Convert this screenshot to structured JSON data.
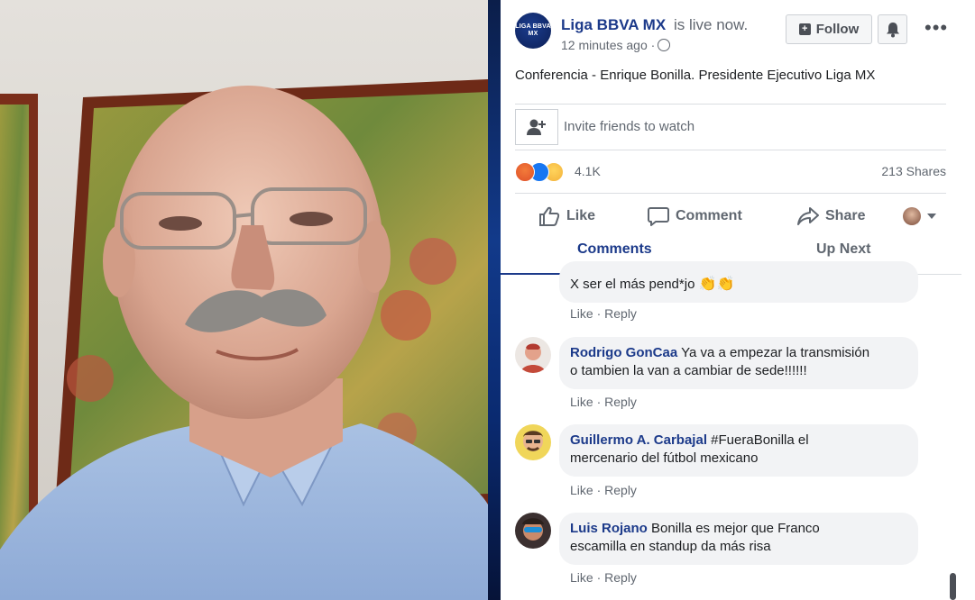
{
  "header": {
    "logo_text": "LIGA BBVA MX",
    "page_name": "Liga BBVA MX",
    "live_text": "is live now.",
    "time": "12 minutes ago ·",
    "follow_label": "Follow"
  },
  "post": {
    "description": "Conferencia - Enrique Bonilla. Presidente Ejecutivo Liga MX",
    "invite_placeholder": "Invite friends to watch",
    "reaction_count": "4.1K",
    "shares": "213 Shares"
  },
  "actions": {
    "like": "Like",
    "comment": "Comment",
    "share": "Share"
  },
  "tabs": {
    "comments": "Comments",
    "up_next": "Up Next"
  },
  "comments": [
    {
      "name": "",
      "text": "X ser el más pend*jo",
      "emoji": "👏👏",
      "like": "Like",
      "reply": "Reply"
    },
    {
      "name": "Rodrigo GonCaa",
      "text_line1": "Ya va a empezar la transmisión",
      "text_line2": "o tambien la van a cambiar de sede!!!!!!",
      "like": "Like",
      "reply": "Reply"
    },
    {
      "name": "Guillermo A. Carbajal",
      "text_line1": "#FueraBonilla el",
      "text_line2": "mercenario del fútbol mexicano",
      "like": "Like",
      "reply": "Reply"
    },
    {
      "name": "Luis Rojano",
      "text_line1": "Bonilla es mejor que Franco",
      "text_line2": "escamilla en standup da más risa",
      "like": "Like",
      "reply": "Reply"
    }
  ],
  "colors": {
    "brand": "#1c3a8a",
    "muted": "#606770",
    "bubble": "#f2f3f5"
  }
}
